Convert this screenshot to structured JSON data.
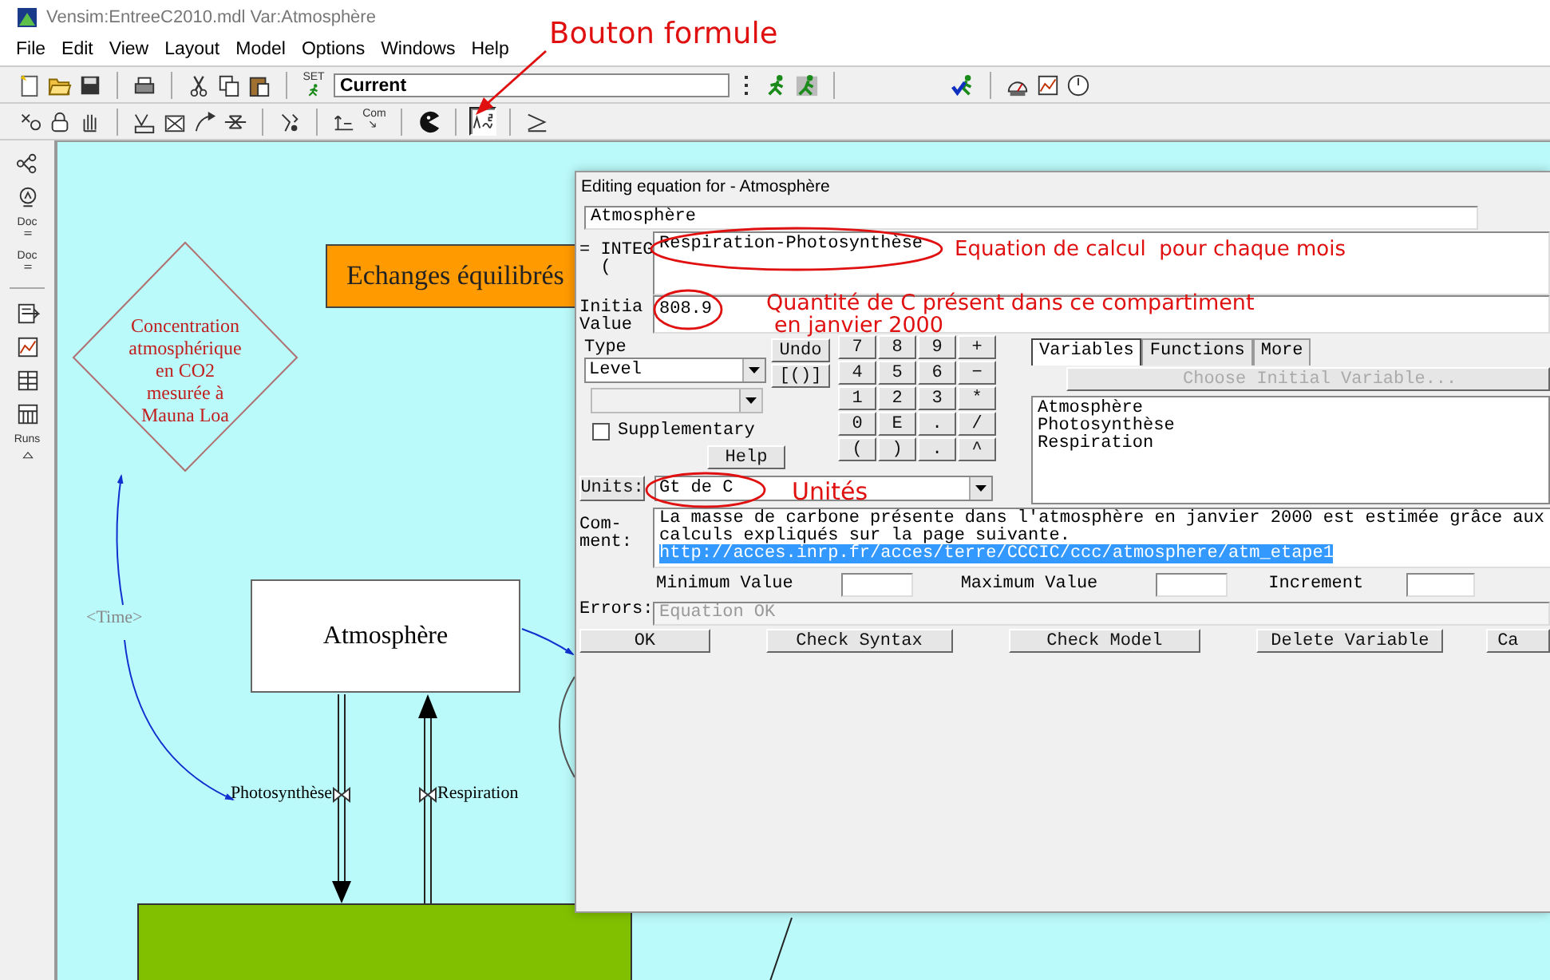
{
  "window": {
    "title": "Vensim:EntreeC2010.mdl Var:Atmosphère"
  },
  "menu": [
    "File",
    "Edit",
    "View",
    "Layout",
    "Model",
    "Options",
    "Windows",
    "Help"
  ],
  "toolbar": [
    {
      "kind": "new"
    },
    {
      "kind": "open"
    },
    {
      "kind": "save"
    },
    {
      "kind": "separator"
    },
    {
      "kind": "print"
    },
    {
      "kind": "separator"
    },
    {
      "kind": "cut"
    },
    {
      "kind": "copy"
    },
    {
      "kind": "paste"
    },
    {
      "kind": "separator"
    },
    {
      "kind": "set",
      "label": "SET"
    }
  ],
  "run_name": {
    "value": "Current"
  },
  "run_tools": [
    {
      "kind": "grip"
    },
    {
      "kind": "run"
    },
    {
      "kind": "runfast"
    },
    {
      "kind": "separator"
    },
    {
      "kind": "check"
    },
    {
      "kind": "separator"
    },
    {
      "kind": "gauge"
    },
    {
      "kind": "graph"
    },
    {
      "kind": "dial"
    }
  ],
  "sketch_tools": [
    {
      "kind": "pointer",
      "selected": false
    },
    {
      "kind": "lock",
      "selected": false
    },
    {
      "kind": "hand",
      "selected": false
    },
    {
      "kind": "separator"
    },
    {
      "kind": "variable",
      "selected": false
    },
    {
      "kind": "box",
      "selected": false
    },
    {
      "kind": "arrow",
      "selected": false
    },
    {
      "kind": "rate",
      "selected": false
    },
    {
      "kind": "separator"
    },
    {
      "kind": "shadow",
      "selected": false
    },
    {
      "kind": "separator"
    },
    {
      "kind": "io",
      "selected": false
    },
    {
      "kind": "comment",
      "label": "Com",
      "selected": false
    },
    {
      "kind": "separator"
    },
    {
      "kind": "delete",
      "selected": false
    },
    {
      "kind": "separator"
    },
    {
      "kind": "formula",
      "selected": true
    },
    {
      "kind": "separator"
    },
    {
      "kind": "reference",
      "selected": false
    }
  ],
  "side_tools": [
    {
      "kind": "tree"
    },
    {
      "kind": "loop"
    },
    {
      "kind": "doc",
      "label": "Doc"
    },
    {
      "kind": "doc",
      "label": "Doc"
    },
    {
      "kind": "separator"
    },
    {
      "kind": "strip"
    },
    {
      "kind": "graph"
    },
    {
      "kind": "table"
    },
    {
      "kind": "table2"
    },
    {
      "kind": "runs",
      "label": "Runs"
    }
  ],
  "diagram": {
    "comment_node": "Concentration\natmosphérique\nen CO2\nmesurée à\nMauna Loa",
    "title_box": "Echanges équilibrés",
    "stock": "Atmosphère",
    "time_label": "<Time>",
    "outflow": "Photosynthèse",
    "inflow": "Respiration"
  },
  "dialog": {
    "title": "Editing equation for - Atmosphère",
    "variable": "Atmosphère",
    "equation_label": "= INTEG\n  (",
    "equation": "Respiration-Photosynthèse",
    "initial_label": "Initia\nValue",
    "initial_value": "808.9",
    "type_label": "Type",
    "type": "Level",
    "supplementary": {
      "label": "Supplementary",
      "checked": false
    },
    "help": "Help",
    "undo": "Undo",
    "brackets": "[()]",
    "keypad": [
      "7",
      "8",
      "9",
      "+",
      "4",
      "5",
      "6",
      "−",
      "1",
      "2",
      "3",
      "*",
      "0",
      "E",
      ".",
      "/",
      "(",
      ")",
      ".",
      "^"
    ],
    "tabs": [
      {
        "label": "Variables",
        "selected": true
      },
      {
        "label": "Functions",
        "selected": false
      },
      {
        "label": "More",
        "selected": false
      }
    ],
    "choose_button": {
      "label": "Choose Initial Variable...",
      "disabled": true
    },
    "variables": [
      "Atmosphère",
      "Photosynthèse",
      "Respiration"
    ],
    "units_button": "Units:",
    "units": "Gt de C",
    "comment_label": "Com-\nment:",
    "comment": "La masse de carbone présente dans l'atmosphère en janvier 2000 est estimée grâce aux calculs expliqués sur la page suivante.",
    "comment_link": "http://acces.inrp.fr/acces/terre/CCCIC/ccc/atmosphere/atm_etape1",
    "min_label": "Minimum Value",
    "max_label": "Maximum Value",
    "increment_label": "Increment",
    "errors_label": "Errors:",
    "errors": "Equation OK",
    "buttons": [
      "OK",
      "Check Syntax",
      "Check Model",
      "Delete Variable",
      "Ca"
    ]
  },
  "annotations": [
    {
      "text": "Bouton formule"
    },
    {
      "text": "Equation de calcul  pour chaque mois"
    },
    {
      "text": "Quantité de C présent dans ce compartiment"
    },
    {
      "text": "en janvier 2000"
    },
    {
      "text": "Unités"
    }
  ]
}
